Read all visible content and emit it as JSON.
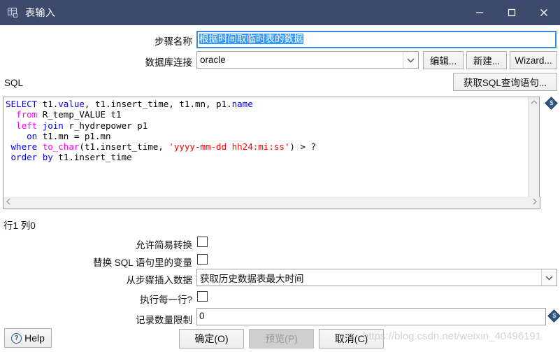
{
  "window": {
    "title": "表输入",
    "icon": "table-input-icon",
    "minimize_label": "minimize-icon",
    "maximize_label": "maximize-icon",
    "close_label": "close-icon",
    "titlebar_color": "#3d4a6b"
  },
  "form": {
    "step_name_label": "步骤名称",
    "step_name_value": "根据时间取临时表的数据",
    "connection_label": "数据库连接",
    "connection_value": "oracle",
    "edit_button": "编辑...",
    "new_button": "新建...",
    "wizard_button": "Wizard...",
    "get_sql_button": "获取SQL查询语句..."
  },
  "sql": {
    "section_label": "SQL",
    "lines": [
      "SELECT t1.value, t1.insert_time, t1.mn, p1.name",
      "  from R_temp_VALUE t1",
      "  left join r_hydrepower p1",
      "    on t1.mn = p1.mn",
      " where to_char(t1.insert_time, 'yyyy-mm-dd hh24:mi:ss') > ?",
      " order by t1.insert_time"
    ],
    "status": "行1 列0",
    "scroll_up_icon": "chevron-up-icon",
    "scroll_down_icon": "chevron-down-icon",
    "scroll_left_icon": "chevron-left-icon",
    "scroll_right_icon": "chevron-right-icon",
    "variable_icon": "variable-diamond-icon"
  },
  "options": {
    "allow_lazy_conversion_label": "允许简易转换",
    "allow_lazy_conversion_checked": false,
    "replace_variables_label": "替换 SQL 语句里的变量",
    "replace_variables_checked": false,
    "insert_data_from_step_label": "从步骤插入数据",
    "insert_data_from_step_value": "获取历史数据表最大时间",
    "execute_for_each_row_label": "执行每一行?",
    "execute_for_each_row_checked": false,
    "limit_label": "记录数量限制",
    "limit_value": "0"
  },
  "footer": {
    "help_label": "Help",
    "help_icon": "question-mark-icon",
    "ok_label": "确定(O)",
    "preview_label": "预览(P)",
    "preview_disabled": true,
    "cancel_label": "取消(C)"
  },
  "watermark": {
    "text": "https://blog.csdn.net/weixin_40496191"
  }
}
